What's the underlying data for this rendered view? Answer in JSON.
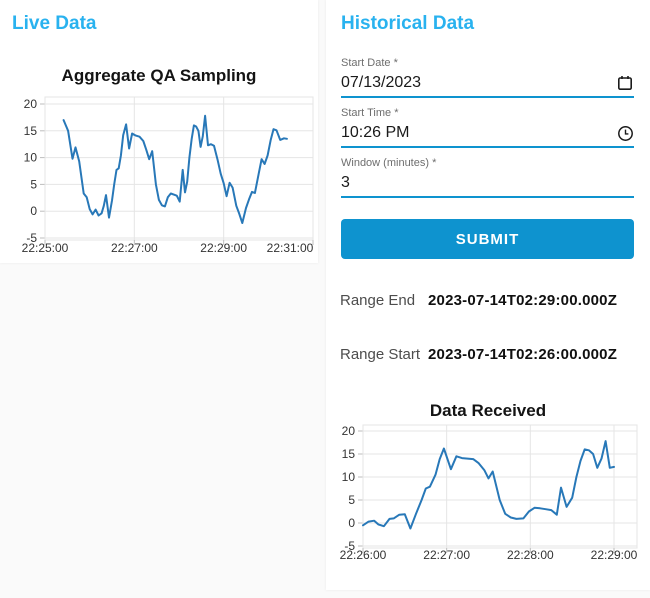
{
  "live_panel": {
    "title": "Live Data"
  },
  "historical_panel": {
    "title": "Historical Data",
    "fields": [
      {
        "label": "Start Date",
        "required_marker": "*",
        "value": "07/13/2023",
        "icon": "calendar-icon"
      },
      {
        "label": "Start Time",
        "required_marker": "*",
        "value": "10:26 PM",
        "icon": "clock-icon"
      },
      {
        "label": "Window (minutes)",
        "required_marker": "*",
        "value": "3",
        "icon": ""
      }
    ],
    "submit_label": "SUBMIT",
    "results": [
      {
        "label": "Range End",
        "value": "2023-07-14T02:29:00.000Z"
      },
      {
        "label": "Range Start",
        "value": "2023-07-14T02:26:00.000Z"
      }
    ]
  },
  "colors": {
    "panel_title_blue": "#29b2ef",
    "primary_blue": "#0e93cf",
    "line_blue": "#2878b8",
    "grid_gray": "#e5e5e5"
  },
  "chart_data": [
    {
      "type": "line",
      "title": "Aggregate QA Sampling",
      "x_ticks": [
        "22:25:00",
        "22:27:00",
        "22:29:00",
        "22:31:00"
      ],
      "y_ticks": [
        20,
        15,
        10,
        5,
        0,
        -5
      ],
      "ylim": [
        -5,
        20
      ],
      "x_axis": {
        "start": "22:25:00",
        "end": "22:31:00",
        "tick_interval_seconds": 120
      },
      "grid": true,
      "legend": false,
      "points": [
        [
          "22:25:25",
          17
        ],
        [
          "22:25:31",
          15
        ],
        [
          "22:25:37",
          9.8
        ],
        [
          "22:25:41",
          11.9
        ],
        [
          "22:25:46",
          9.3
        ],
        [
          "22:25:52",
          3.3
        ],
        [
          "22:25:56",
          2.6
        ],
        [
          "22:26:00",
          0.4
        ],
        [
          "22:26:04",
          -0.6
        ],
        [
          "22:26:08",
          0.3
        ],
        [
          "22:26:12",
          -0.8
        ],
        [
          "22:26:16",
          -0.4
        ],
        [
          "22:26:19",
          1.0
        ],
        [
          "22:26:22",
          3.0
        ],
        [
          "22:26:26",
          -1.2
        ],
        [
          "22:26:30",
          2.0
        ],
        [
          "22:26:33",
          5.0
        ],
        [
          "22:26:36",
          7.7
        ],
        [
          "22:26:39",
          8.0
        ],
        [
          "22:26:42",
          10.4
        ],
        [
          "22:26:45",
          14.2
        ],
        [
          "22:26:49",
          16.2
        ],
        [
          "22:26:53",
          11.7
        ],
        [
          "22:26:57",
          14.5
        ],
        [
          "22:27:02",
          14.1
        ],
        [
          "22:27:07",
          13.9
        ],
        [
          "22:27:12",
          13.1
        ],
        [
          "22:27:16",
          11.5
        ],
        [
          "22:27:20",
          9.7
        ],
        [
          "22:27:24",
          11.2
        ],
        [
          "22:27:29",
          5.0
        ],
        [
          "22:27:33",
          2.1
        ],
        [
          "22:27:37",
          1.1
        ],
        [
          "22:27:41",
          0.9
        ],
        [
          "22:27:45",
          2.6
        ],
        [
          "22:27:49",
          3.3
        ],
        [
          "22:27:53",
          3.1
        ],
        [
          "22:27:57",
          2.9
        ],
        [
          "22:28:01",
          1.8
        ],
        [
          "22:28:05",
          7.7
        ],
        [
          "22:28:08",
          3.5
        ],
        [
          "22:28:11",
          5.5
        ],
        [
          "22:28:14",
          10.0
        ],
        [
          "22:28:17",
          13.5
        ],
        [
          "22:28:20",
          16.0
        ],
        [
          "22:28:23",
          15.8
        ],
        [
          "22:28:26",
          15.0
        ],
        [
          "22:28:29",
          12.0
        ],
        [
          "22:28:32",
          14.0
        ],
        [
          "22:28:35",
          17.8
        ],
        [
          "22:28:39",
          12.3
        ],
        [
          "22:28:43",
          12.5
        ],
        [
          "22:28:47",
          12.2
        ],
        [
          "22:28:52",
          9.5
        ],
        [
          "22:28:56",
          7.0
        ],
        [
          "22:29:00",
          5.2
        ],
        [
          "22:29:04",
          2.8
        ],
        [
          "22:29:08",
          5.3
        ],
        [
          "22:29:12",
          4.4
        ],
        [
          "22:29:17",
          1.0
        ],
        [
          "22:29:21",
          -0.5
        ],
        [
          "22:29:25",
          -2.2
        ],
        [
          "22:29:30",
          0.6
        ],
        [
          "22:29:34",
          2.2
        ],
        [
          "22:29:38",
          3.6
        ],
        [
          "22:29:42",
          3.4
        ],
        [
          "22:29:47",
          7.0
        ],
        [
          "22:29:51",
          9.7
        ],
        [
          "22:29:55",
          8.8
        ],
        [
          "22:29:59",
          10.4
        ],
        [
          "22:30:03",
          13.2
        ],
        [
          "22:30:07",
          15.3
        ],
        [
          "22:30:11",
          15.1
        ],
        [
          "22:30:16",
          13.3
        ],
        [
          "22:30:21",
          13.6
        ],
        [
          "22:30:25",
          13.5
        ]
      ]
    },
    {
      "type": "line",
      "title": "Data Received",
      "x_ticks": [
        "22:26:00",
        "22:27:00",
        "22:28:00",
        "22:29:00"
      ],
      "y_ticks": [
        20,
        15,
        10,
        5,
        0,
        -5
      ],
      "ylim": [
        -5,
        20
      ],
      "x_axis": {
        "start": "22:26:00",
        "end": "22:29:00",
        "tick_interval_seconds": 60
      },
      "grid": true,
      "legend": false,
      "points": [
        [
          "22:26:00",
          -0.5
        ],
        [
          "22:26:04",
          0.3
        ],
        [
          "22:26:08",
          0.5
        ],
        [
          "22:26:11",
          -0.3
        ],
        [
          "22:26:15",
          -0.7
        ],
        [
          "22:26:19",
          0.9
        ],
        [
          "22:26:22",
          1.0
        ],
        [
          "22:26:26",
          1.8
        ],
        [
          "22:26:30",
          1.9
        ],
        [
          "22:26:34",
          -1.2
        ],
        [
          "22:26:38",
          2.0
        ],
        [
          "22:26:42",
          5.0
        ],
        [
          "22:26:45",
          7.5
        ],
        [
          "22:26:48",
          7.9
        ],
        [
          "22:26:52",
          10.5
        ],
        [
          "22:26:55",
          13.9
        ],
        [
          "22:26:58",
          16.2
        ],
        [
          "22:27:03",
          11.7
        ],
        [
          "22:27:07",
          14.5
        ],
        [
          "22:27:11",
          14.1
        ],
        [
          "22:27:15",
          14.0
        ],
        [
          "22:27:19",
          13.9
        ],
        [
          "22:27:23",
          13.0
        ],
        [
          "22:27:27",
          11.5
        ],
        [
          "22:27:30",
          9.7
        ],
        [
          "22:27:33",
          11.2
        ],
        [
          "22:27:38",
          5.0
        ],
        [
          "22:27:42",
          2.0
        ],
        [
          "22:27:46",
          1.2
        ],
        [
          "22:27:50",
          0.9
        ],
        [
          "22:27:55",
          1.0
        ],
        [
          "22:27:59",
          2.5
        ],
        [
          "22:28:03",
          3.3
        ],
        [
          "22:28:07",
          3.2
        ],
        [
          "22:28:11",
          3.0
        ],
        [
          "22:28:15",
          2.8
        ],
        [
          "22:28:19",
          1.8
        ],
        [
          "22:28:22",
          7.7
        ],
        [
          "22:28:26",
          3.5
        ],
        [
          "22:28:30",
          5.5
        ],
        [
          "22:28:33",
          10.0
        ],
        [
          "22:28:36",
          13.5
        ],
        [
          "22:28:39",
          16.0
        ],
        [
          "22:28:42",
          15.8
        ],
        [
          "22:28:45",
          15.0
        ],
        [
          "22:28:48",
          12.0
        ],
        [
          "22:28:51",
          14.0
        ],
        [
          "22:28:54",
          17.8
        ],
        [
          "22:28:57",
          12.0
        ],
        [
          "22:29:00",
          12.2
        ]
      ]
    }
  ]
}
